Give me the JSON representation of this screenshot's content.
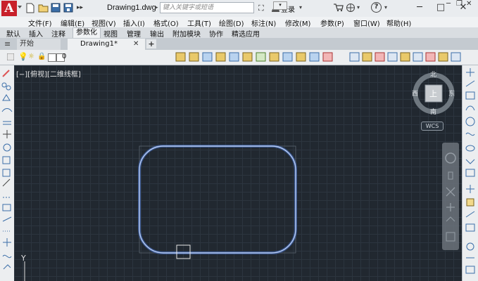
{
  "titlebar": {
    "app_logo": "A",
    "document_title": "Drawing1.dwg",
    "search_placeholder": "键入关键字或短语",
    "login_label": "登录",
    "help_label": "?",
    "minimize": "─",
    "maximize": "□",
    "close": "✕"
  },
  "menubar": {
    "items": [
      "文件(F)",
      "编辑(E)",
      "视图(V)",
      "插入(I)",
      "格式(O)",
      "工具(T)",
      "绘图(D)",
      "标注(N)",
      "修改(M)",
      "参数(P)",
      "窗口(W)",
      "帮助(H)"
    ]
  },
  "ribbon": {
    "tabs": [
      "默认",
      "插入",
      "注释",
      "参数化",
      "视图",
      "管理",
      "输出",
      "附加模块",
      "协作",
      "精选应用"
    ],
    "active_tab": "参数化"
  },
  "file_tabs": {
    "start": "开始",
    "drawing": "Drawing1*",
    "close": "✕",
    "add": "+"
  },
  "layer": {
    "name": "0"
  },
  "viewport": {
    "label": "[−][俯视][二维线框]"
  },
  "viewcube": {
    "north": "北",
    "south": "南",
    "east": "东",
    "west": "西",
    "top": "上",
    "wcs": "WCS"
  },
  "ucs": {
    "y_label": "Y"
  },
  "colors": {
    "canvas_bg": "#212830",
    "grid_line": "#2c353f",
    "shape_stroke": "#b8ccf2",
    "shape_glow": "#4a78d8",
    "logo_red": "#c8202a"
  }
}
